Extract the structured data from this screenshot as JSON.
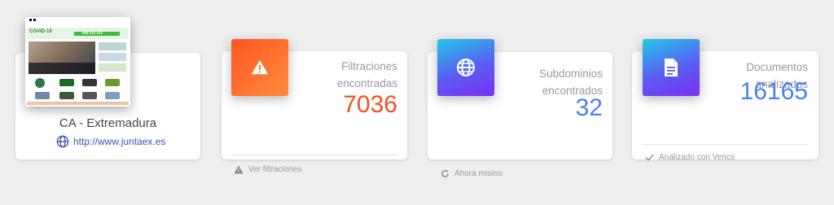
{
  "site": {
    "name": "CA - Extremadura",
    "url": "http://www.juntaex.es",
    "thumb_text": {
      "brand": "COVID-19",
      "phone": "900 222 012"
    }
  },
  "cards": {
    "leaks": {
      "label": "Filtraciones encontradas",
      "value": "7036",
      "value_color": "#f4511e",
      "footer": "Ver filtraciones",
      "icon": "warning-icon"
    },
    "subdomains": {
      "label": "Subdominios encontrados",
      "value": "32",
      "value_color": "#4a80f0",
      "footer": "Ahora mismo",
      "icon": "globe-icon"
    },
    "documents": {
      "label": "Documentos analizados",
      "value": "16165",
      "value_color": "#4a80f0",
      "footer": "Analizado con Verics",
      "icon": "document-icon"
    }
  },
  "colors": {
    "orange_gradient": [
      "#ff5722",
      "#ff8a3d"
    ],
    "blue_gradient": [
      "#21c9e8",
      "#7b2ff7"
    ]
  }
}
